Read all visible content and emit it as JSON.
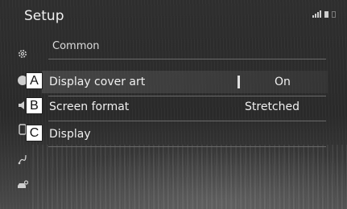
{
  "header": {
    "title": "Setup"
  },
  "sidebar": {
    "icons": [
      "gear-icon",
      "sound-icon",
      "volume-icon",
      "phone-icon",
      "route-icon",
      "car-icon"
    ]
  },
  "main": {
    "section_title": "Common",
    "rows": [
      {
        "callout": "A",
        "label": "Display cover art",
        "value": "On"
      },
      {
        "callout": "B",
        "label": "Screen format",
        "value": "Stretched"
      },
      {
        "callout": "C",
        "label": "Display",
        "value": ""
      }
    ]
  },
  "colors": {
    "background": "#2c2c2c",
    "text": "#f0f0f0",
    "separator": "#6a6a6a"
  }
}
